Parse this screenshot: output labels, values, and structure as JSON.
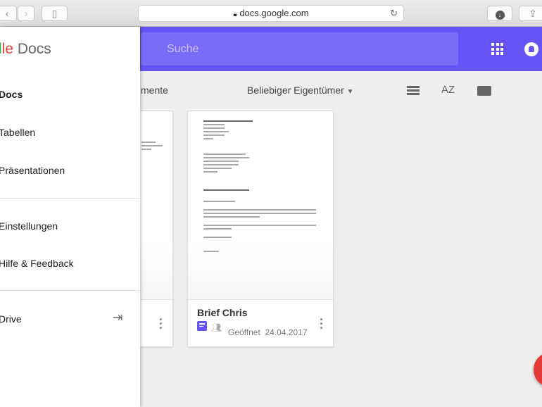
{
  "browser": {
    "url": "docs.google.com"
  },
  "header": {
    "search_placeholder": "Suche"
  },
  "drawer": {
    "logo_tail": "le",
    "logo_product": "Docs",
    "items": [
      {
        "label": "Docs"
      },
      {
        "label": "Tabellen"
      },
      {
        "label": "Präsentationen"
      },
      {
        "label": "Einstellungen"
      },
      {
        "label": "Hilfe & Feedback"
      },
      {
        "label": "Drive"
      }
    ]
  },
  "toolbar": {
    "recent_label": "mente",
    "owner_filter": "Beliebiger Eigentümer",
    "sort_label": "AZ"
  },
  "files": [
    {
      "title": "Brief Chris",
      "opened_label": "Geöffnet",
      "date": "24.04.2017"
    }
  ],
  "colors": {
    "accent": "#6553f5",
    "fab": "#e53935"
  }
}
